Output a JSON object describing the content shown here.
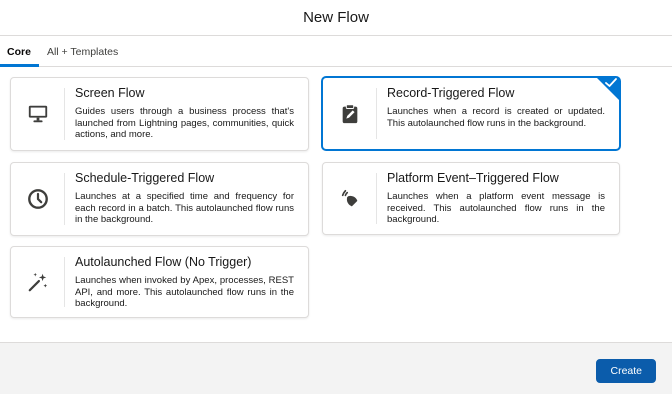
{
  "modal": {
    "title": "New Flow"
  },
  "tabs": [
    {
      "label": "Core",
      "active": true
    },
    {
      "label": "All + Templates",
      "active": false
    }
  ],
  "flow_types": [
    {
      "title": "Screen Flow",
      "description": "Guides users through a business process that's launched from Lightning pages, communities, quick actions, and more.",
      "icon": "monitor-icon",
      "selected": false
    },
    {
      "title": "Record-Triggered Flow",
      "description": "Launches when a record is created or updated. This autolaunched flow runs in the background.",
      "icon": "clipboard-pencil-icon",
      "selected": true
    },
    {
      "title": "Schedule-Triggered Flow",
      "description": "Launches at a specified time and frequency for each record in a batch. This autolaunched flow runs in the background.",
      "icon": "clock-icon",
      "selected": false
    },
    {
      "title": "Platform Event–Triggered Flow",
      "description": "Launches when a platform event message is received. This autolaunched flow runs in the background.",
      "icon": "broadcast-signal-icon",
      "selected": false
    },
    {
      "title": "Autolaunched Flow (No Trigger)",
      "description": "Launches when invoked by Apex, processes, REST API, and more. This autolaunched flow runs in the background.",
      "icon": "magic-wand-icon",
      "selected": false
    }
  ],
  "footer": {
    "create_label": "Create"
  },
  "colors": {
    "accent": "#0176d3",
    "button": "#0b5cab",
    "icon": "#3e3e3c"
  }
}
